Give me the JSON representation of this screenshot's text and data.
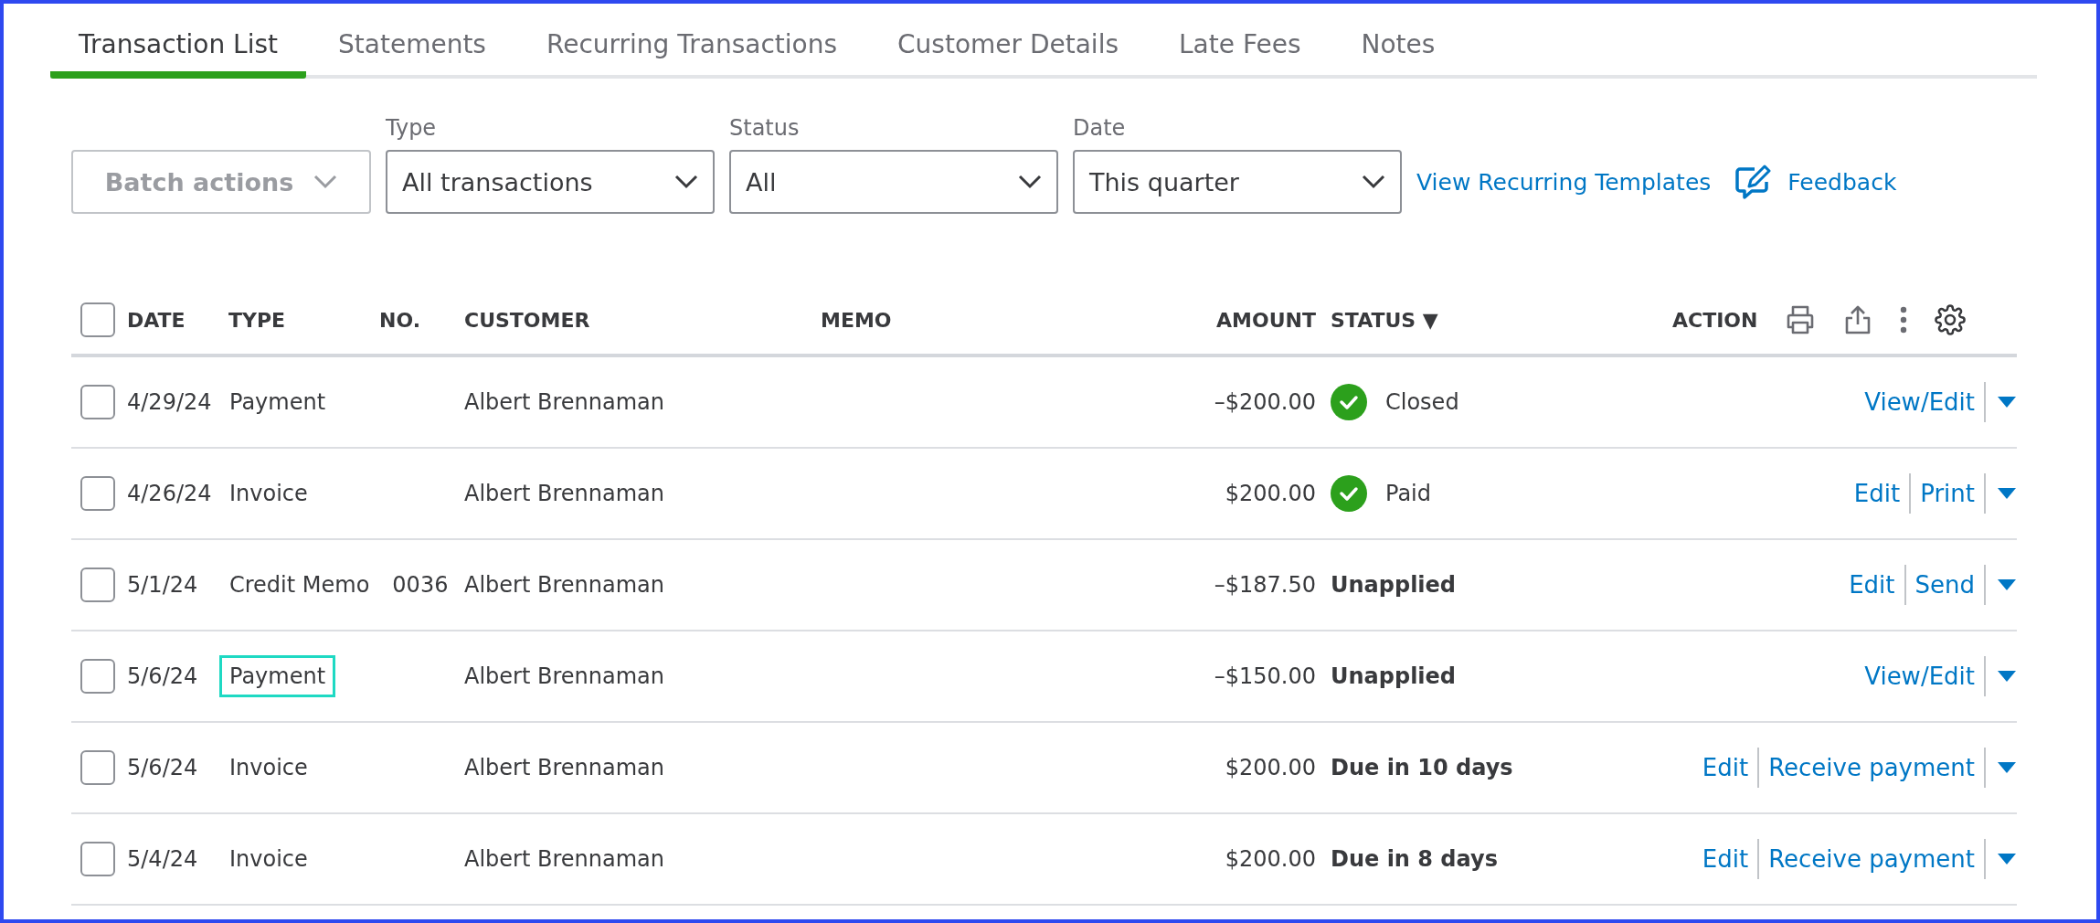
{
  "tabs": [
    {
      "label": "Transaction List",
      "selected": true
    },
    {
      "label": "Statements",
      "selected": false
    },
    {
      "label": "Recurring Transactions",
      "selected": false
    },
    {
      "label": "Customer Details",
      "selected": false
    },
    {
      "label": "Late Fees",
      "selected": false
    },
    {
      "label": "Notes",
      "selected": false
    }
  ],
  "toolbar": {
    "batch_actions": {
      "label": "Batch actions",
      "disabled": true
    },
    "filters": [
      {
        "label": "Type",
        "value": "All transactions"
      },
      {
        "label": "Status",
        "value": "All"
      },
      {
        "label": "Date",
        "value": "This quarter"
      }
    ],
    "link": "View Recurring Templates",
    "feedback": "Feedback"
  },
  "table": {
    "select_all_checked": false,
    "columns": [
      "DATE",
      "TYPE",
      "NO.",
      "CUSTOMER",
      "MEMO",
      "AMOUNT",
      "STATUS ▼",
      "ACTION"
    ],
    "rows": [
      {
        "checked": false,
        "date": "4/29/24",
        "type": "Payment",
        "type_highlighted": false,
        "no": "",
        "customer": "Albert Brennaman",
        "amount": "–$200.00",
        "status": "Closed",
        "complete": true,
        "actions": [
          "View/Edit"
        ]
      },
      {
        "checked": false,
        "date": "4/26/24",
        "type": "Invoice",
        "type_highlighted": false,
        "no": "",
        "customer": "Albert Brennaman",
        "amount": "$200.00",
        "status": "Paid",
        "complete": true,
        "actions": [
          "Edit",
          "Print"
        ]
      },
      {
        "checked": false,
        "date": "5/1/24",
        "type": "Credit Memo",
        "type_highlighted": false,
        "no": "0036",
        "customer": "Albert Brennaman",
        "amount": "–$187.50",
        "status": "Unapplied",
        "complete": false,
        "actions": [
          "Edit",
          "Send"
        ]
      },
      {
        "checked": false,
        "date": "5/6/24",
        "type": "Payment",
        "type_highlighted": true,
        "no": "",
        "customer": "Albert Brennaman",
        "amount": "–$150.00",
        "status": "Unapplied",
        "complete": false,
        "actions": [
          "View/Edit"
        ]
      },
      {
        "checked": false,
        "date": "5/6/24",
        "type": "Invoice",
        "type_highlighted": false,
        "no": "",
        "customer": "Albert Brennaman",
        "amount": "$200.00",
        "status": "Due in 10 days",
        "complete": false,
        "actions": [
          "Edit",
          "Receive payment"
        ]
      },
      {
        "checked": false,
        "date": "5/4/24",
        "type": "Invoice",
        "type_highlighted": false,
        "no": "",
        "customer": "Albert Brennaman",
        "amount": "$200.00",
        "status": "Due in 8 days",
        "complete": false,
        "actions": [
          "Edit",
          "Receive payment"
        ]
      }
    ]
  }
}
